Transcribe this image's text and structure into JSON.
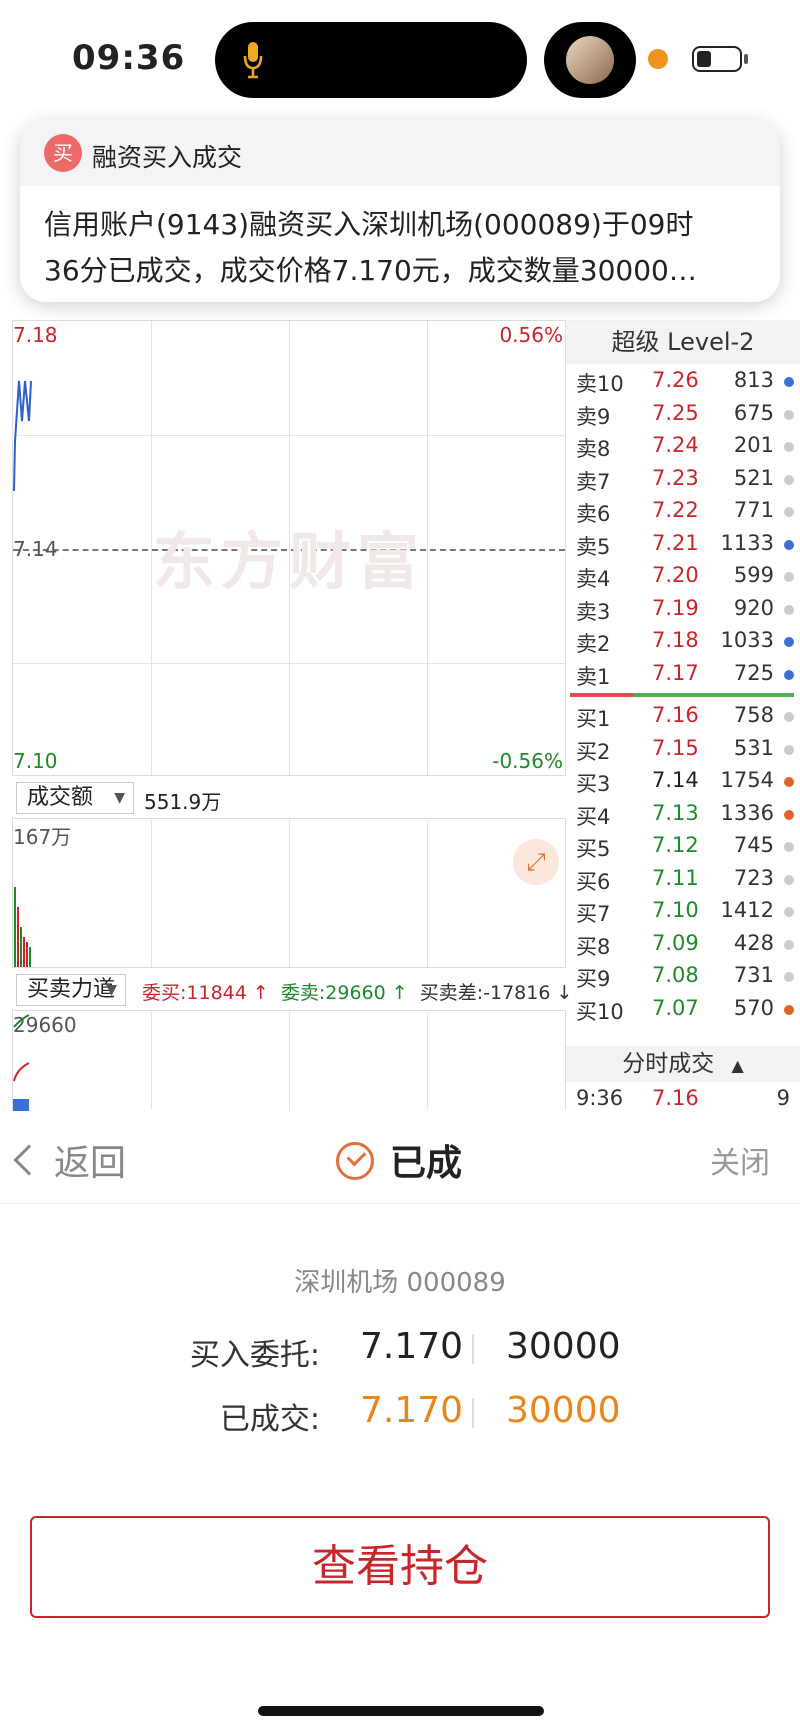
{
  "status_bar": {
    "time": "09:36"
  },
  "notification": {
    "badge": "买",
    "title": "融资买入成交",
    "body_line1": "信用账户(9143)融资买入深圳机场(000089)于09时",
    "body_line2": "36分已成交，成交价格7.170元，成交数量30000…"
  },
  "main_chart": {
    "price_high": "7.18",
    "price_low": "7.10",
    "price_mid": "7.14",
    "pct_high": "0.56%",
    "pct_low": "-0.56%",
    "watermark": "东方财富"
  },
  "volume_panel": {
    "selector": "成交额",
    "value": "551.9万",
    "axis_max": "167万"
  },
  "force_panel": {
    "selector": "买卖力道",
    "bid": "委买:11844 ↑",
    "ask": "委卖:29660 ↑",
    "diff": "买卖差:-17816 ↓",
    "axis_max": "29660"
  },
  "order_book": {
    "title": "超级 Level-2",
    "asks": [
      {
        "label": "卖10",
        "price": "7.26",
        "vol": "813",
        "dot": "#3a6fd8"
      },
      {
        "label": "卖9",
        "price": "7.25",
        "vol": "675",
        "dot": "#cccccc"
      },
      {
        "label": "卖8",
        "price": "7.24",
        "vol": "201",
        "dot": "#cccccc"
      },
      {
        "label": "卖7",
        "price": "7.23",
        "vol": "521",
        "dot": "#cccccc"
      },
      {
        "label": "卖6",
        "price": "7.22",
        "vol": "771",
        "dot": "#cccccc"
      },
      {
        "label": "卖5",
        "price": "7.21",
        "vol": "1133",
        "dot": "#3a6fd8"
      },
      {
        "label": "卖4",
        "price": "7.20",
        "vol": "599",
        "dot": "#cccccc"
      },
      {
        "label": "卖3",
        "price": "7.19",
        "vol": "920",
        "dot": "#cccccc"
      },
      {
        "label": "卖2",
        "price": "7.18",
        "vol": "1033",
        "dot": "#3a6fd8"
      },
      {
        "label": "卖1",
        "price": "7.17",
        "vol": "725",
        "dot": "#3a6fd8"
      }
    ],
    "bids": [
      {
        "label": "买1",
        "price": "7.16",
        "vol": "758",
        "dot": "#cccccc"
      },
      {
        "label": "买2",
        "price": "7.15",
        "vol": "531",
        "dot": "#cccccc"
      },
      {
        "label": "买3",
        "price": "7.14",
        "vol": "1754",
        "dot": "#e0642a"
      },
      {
        "label": "买4",
        "price": "7.13",
        "vol": "1336",
        "dot": "#e0642a"
      },
      {
        "label": "买5",
        "price": "7.12",
        "vol": "745",
        "dot": "#cccccc"
      },
      {
        "label": "买6",
        "price": "7.11",
        "vol": "723",
        "dot": "#cccccc"
      },
      {
        "label": "买7",
        "price": "7.10",
        "vol": "1412",
        "dot": "#cccccc"
      },
      {
        "label": "买8",
        "price": "7.09",
        "vol": "428",
        "dot": "#cccccc"
      },
      {
        "label": "买9",
        "price": "7.08",
        "vol": "731",
        "dot": "#cccccc"
      },
      {
        "label": "买10",
        "price": "7.07",
        "vol": "570",
        "dot": "#e0642a"
      }
    ],
    "trades_title": "分时成交",
    "trade": {
      "time": "9:36",
      "price": "7.16",
      "vol": "9"
    }
  },
  "sheet": {
    "back_label": "返回",
    "status_label": "已成",
    "close_label": "关闭",
    "stock": "深圳机场 000089",
    "order_label": "买入委托:",
    "order_price": "7.170",
    "order_qty": "30000",
    "filled_label": "已成交:",
    "filled_price": "7.170",
    "filled_qty": "30000",
    "hold_button": "查看持仓"
  },
  "colors": {
    "up": "#c8262b",
    "down": "#1f8a2a",
    "accent": "#e8861b"
  }
}
